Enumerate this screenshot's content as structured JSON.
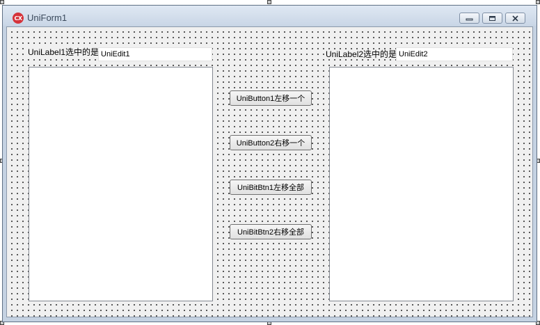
{
  "window": {
    "title": "UniForm1",
    "icon": "cx-logo-icon",
    "controls": [
      "minimize-icon",
      "maximize-icon",
      "close-icon"
    ]
  },
  "left": {
    "label": "UniLabel1选中的是",
    "edit_value": "UniEdit1"
  },
  "right": {
    "label": "UniLabel2选中的是",
    "edit_value": "UniEdit2"
  },
  "buttons": {
    "button1": "UniButton1左移一个",
    "button2": "UniButton2右移一个",
    "bitbtn1": "UniBitBtn1左移全部",
    "bitbtn2": "UniBitBtn2右移全部"
  },
  "icon_text": "CX",
  "colors": {
    "title_bar": "#c9d6e6",
    "form_background": "#f0f0f0",
    "icon_red": "#d5333a"
  }
}
